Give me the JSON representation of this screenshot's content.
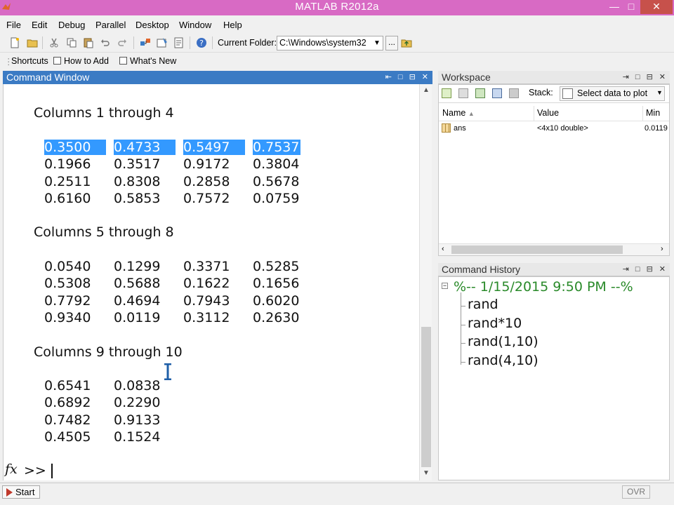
{
  "window": {
    "title": "MATLAB  R2012a",
    "min_glyph": "—",
    "max_glyph": "□",
    "close_glyph": "✕"
  },
  "menu": [
    "File",
    "Edit",
    "Debug",
    "Parallel",
    "Desktop",
    "Window",
    "Help"
  ],
  "toolbar": {
    "current_folder_label": "Current Folder:",
    "current_folder_value": "C:\\Windows\\system32",
    "browse_label": "...",
    "help_glyph": "?"
  },
  "shortcuts": {
    "label": "Shortcuts",
    "how_to_add": "How to Add",
    "whats_new": "What's New"
  },
  "command_window": {
    "title": "Command Window",
    "blocks": [
      {
        "header": "Columns 1 through 4",
        "rows": [
          [
            "0.3500",
            "0.4733",
            "0.5497",
            "0.7537"
          ],
          [
            "0.1966",
            "0.3517",
            "0.9172",
            "0.3804"
          ],
          [
            "0.2511",
            "0.8308",
            "0.2858",
            "0.5678"
          ],
          [
            "0.6160",
            "0.5853",
            "0.7572",
            "0.0759"
          ]
        ]
      },
      {
        "header": "Columns 5 through 8",
        "rows": [
          [
            "0.0540",
            "0.1299",
            "0.3371",
            "0.5285"
          ],
          [
            "0.5308",
            "0.5688",
            "0.1622",
            "0.1656"
          ],
          [
            "0.7792",
            "0.4694",
            "0.7943",
            "0.6020"
          ],
          [
            "0.9340",
            "0.0119",
            "0.3112",
            "0.2630"
          ]
        ]
      },
      {
        "header": "Columns 9 through 10",
        "rows": [
          [
            "0.6541",
            "0.0838"
          ],
          [
            "0.6892",
            "0.2290"
          ],
          [
            "0.7482",
            "0.9133"
          ],
          [
            "0.4505",
            "0.1524"
          ]
        ]
      }
    ],
    "prompt_fx": "fx",
    "prompt": ">> "
  },
  "workspace": {
    "title": "Workspace",
    "stack_label": "Stack:",
    "select_data_label": "Select data to plot",
    "columns": [
      "Name",
      "Value",
      "Min"
    ],
    "rows": [
      {
        "name": "ans",
        "value": "<4x10 double>",
        "min": "0.0119"
      }
    ]
  },
  "command_history": {
    "title": "Command History",
    "session": "%-- 1/15/2015 9:50 PM --%",
    "items": [
      "rand",
      "rand*10",
      "rand(1,10)",
      "rand(4,10)"
    ]
  },
  "statusbar": {
    "start_label": "Start",
    "ovr_label": "OVR"
  },
  "colors": {
    "active_header": "#3b7bc4",
    "title_bar": "#d86ac4",
    "selection": "#3399ff",
    "history_session": "#2a8a2a"
  }
}
